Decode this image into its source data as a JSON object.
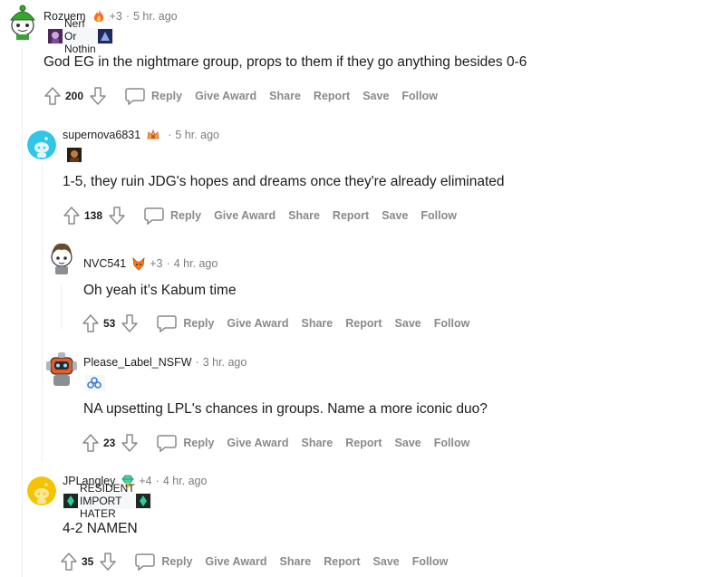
{
  "comments": [
    {
      "author": "Rozuem",
      "extra_awards": "+3",
      "time": "5 hr. ago",
      "flair": "Nerf Or Nothin",
      "body": "God EG in the nightmare group, props to them if they go anything besides 0-6",
      "score": "200"
    },
    {
      "author": "supernova6831",
      "extra_awards": "",
      "time": "5 hr. ago",
      "flair": "",
      "body": "1-5, they ruin JDG's hopes and dreams once they're already eliminated",
      "score": "138"
    },
    {
      "author": "NVC541",
      "extra_awards": "+3",
      "time": "4 hr. ago",
      "flair": "",
      "body": "Oh yeah it’s Kabum time",
      "score": "53"
    },
    {
      "author": "Please_Label_NSFW",
      "extra_awards": "",
      "time": "3 hr. ago",
      "flair": "",
      "body": "NA upsetting LPL's chances in groups. Name a more iconic duo?",
      "score": "23"
    },
    {
      "author": "JPLangley",
      "extra_awards": "+4",
      "time": "4 hr. ago",
      "flair": "RESIDENT IMPORT HATER",
      "body": "4-2 NAMEN",
      "score": "35"
    }
  ],
  "actions": {
    "reply": "Reply",
    "give_award": "Give Award",
    "share": "Share",
    "report": "Report",
    "save": "Save",
    "follow": "Follow"
  },
  "separator": "·",
  "colors": {
    "text": "#1c1c1c",
    "meta": "#7c7c7c",
    "action": "#878a8c",
    "thread_line": "#edeff1",
    "avatar_teal": "#30c6e8",
    "avatar_yellow": "#f5c300",
    "snoo_green": "#3aa335"
  },
  "icons": {
    "upvote": "upvote-arrow-icon",
    "downvote": "downvote-arrow-icon",
    "reply": "speech-bubble-icon"
  }
}
